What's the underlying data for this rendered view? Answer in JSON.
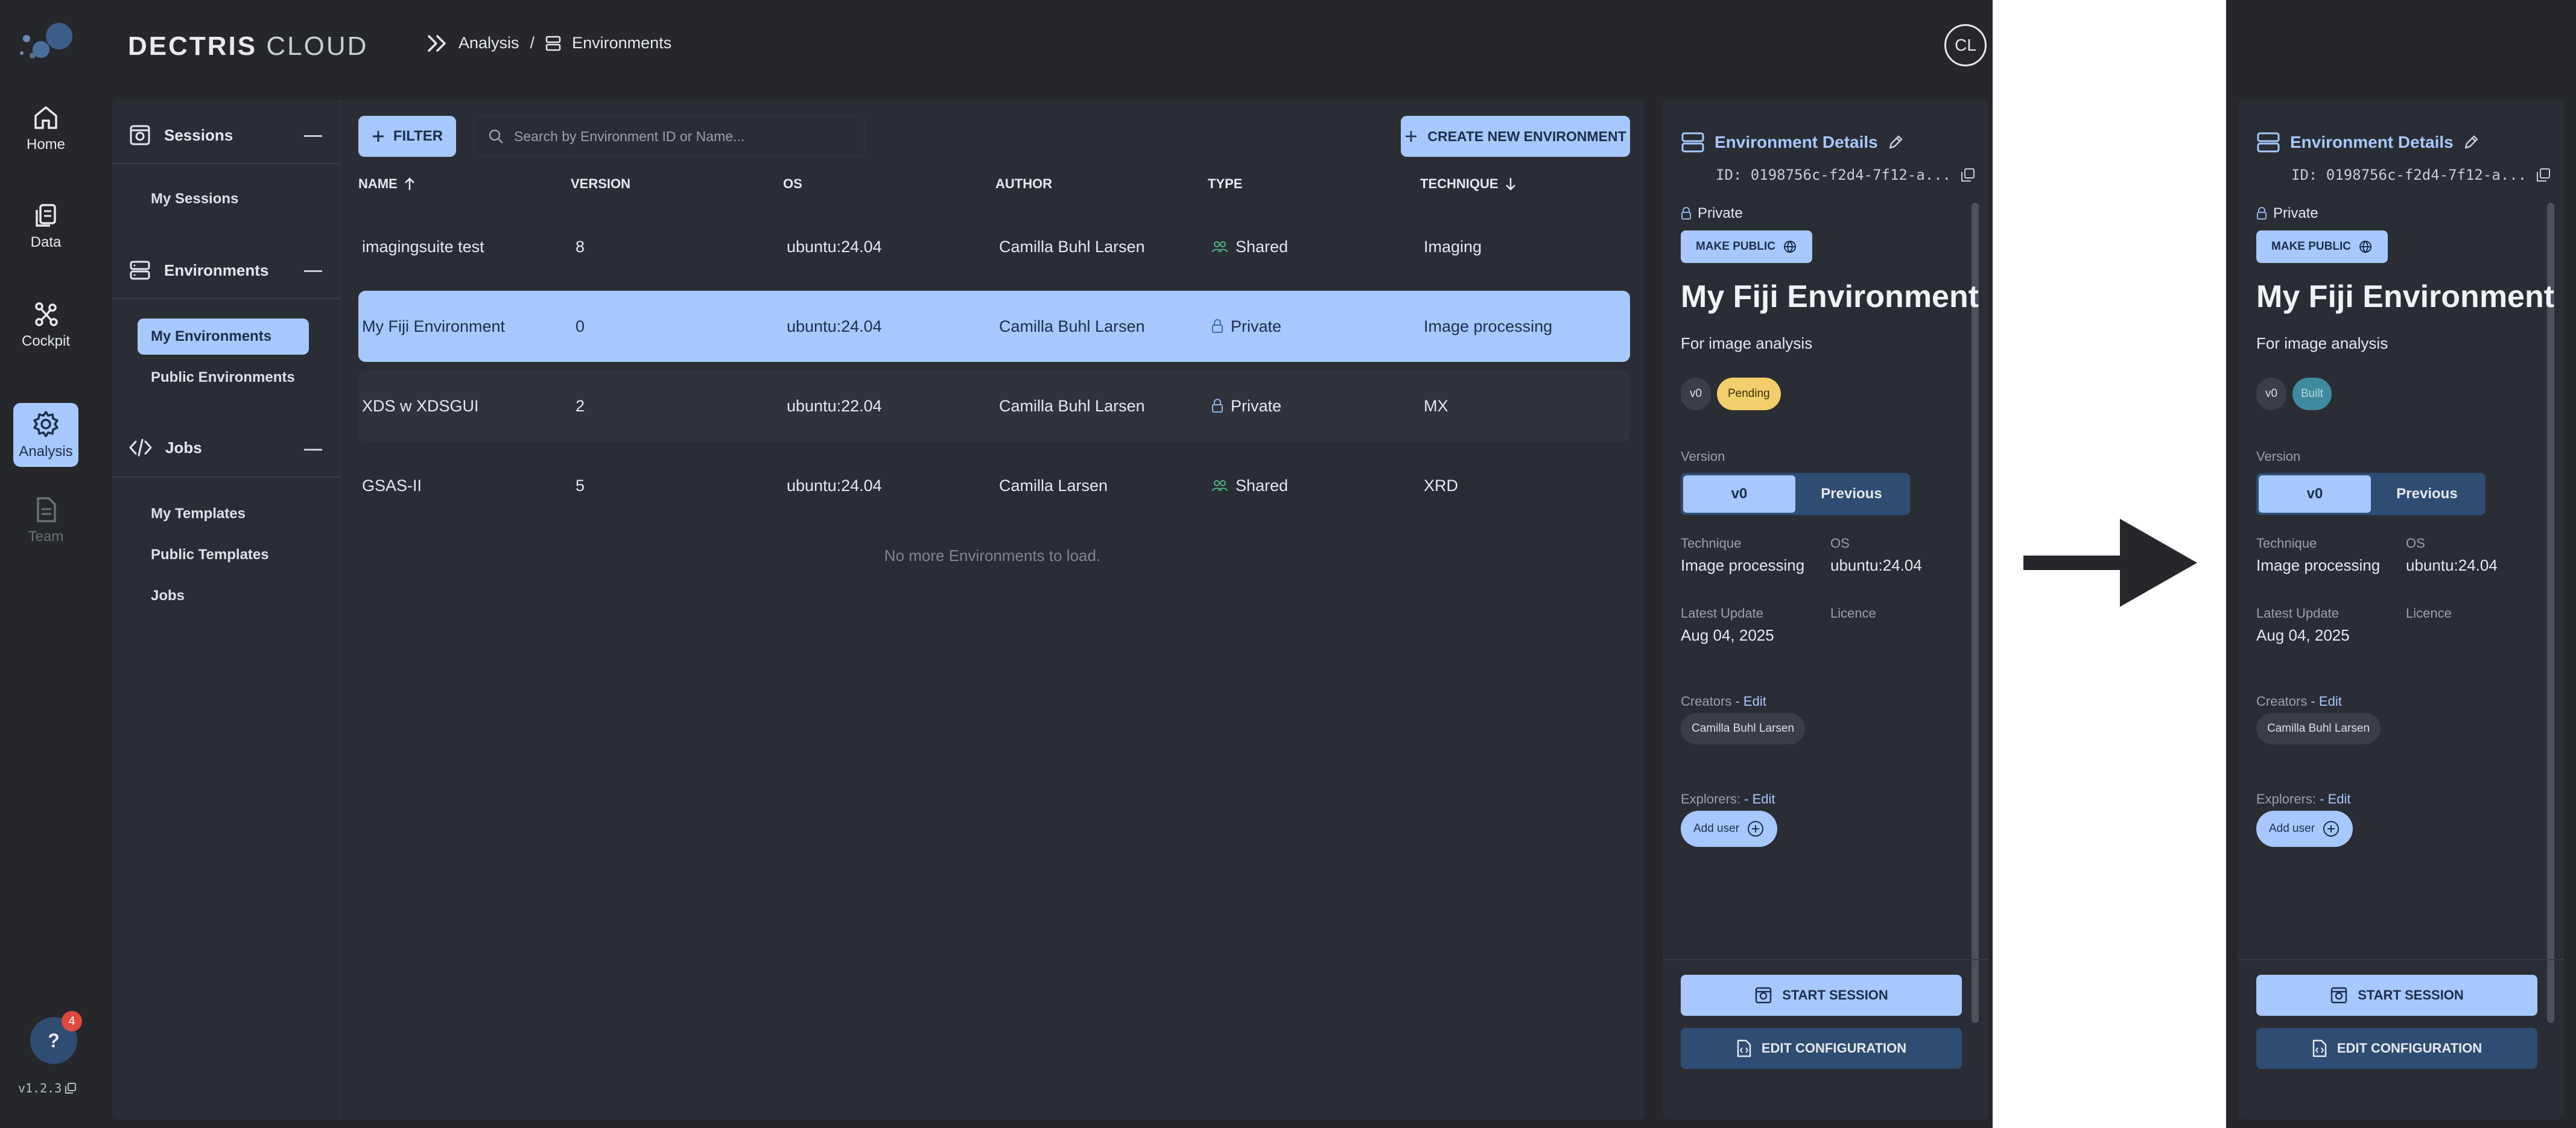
{
  "brand": {
    "bold": "DECTRIS",
    "light": "CLOUD"
  },
  "breadcrumb": {
    "section": "Analysis",
    "separator": "/",
    "page": "Environments"
  },
  "user": {
    "initials": "CL"
  },
  "rail": {
    "items": [
      {
        "label": "Home",
        "icon": "home-icon"
      },
      {
        "label": "Data",
        "icon": "data-icon"
      },
      {
        "label": "Cockpit",
        "icon": "cockpit-icon"
      },
      {
        "label": "Analysis",
        "icon": "gear-icon",
        "active": true
      },
      {
        "label": "Team",
        "icon": "document-icon",
        "disabled": true
      }
    ],
    "help": {
      "label": "?",
      "badge": "4"
    },
    "version": "v1.2.3"
  },
  "nav": {
    "sessions": {
      "title": "Sessions",
      "items": [
        "My Sessions"
      ]
    },
    "environments": {
      "title": "Environments",
      "items": [
        "My Environments",
        "Public Environments"
      ]
    },
    "jobs": {
      "title": "Jobs",
      "items": [
        "My Templates",
        "Public Templates",
        "Jobs"
      ]
    }
  },
  "toolbar": {
    "filter_label": "FILTER",
    "search_placeholder": "Search by Environment ID or Name...",
    "create_label": "CREATE NEW ENVIRONMENT"
  },
  "table": {
    "headers": {
      "name": "NAME",
      "version": "VERSION",
      "os": "OS",
      "author": "AUTHOR",
      "type": "TYPE",
      "technique": "TECHNIQUE"
    },
    "rows": [
      {
        "name": "imagingsuite test",
        "version": "8",
        "os": "ubuntu:24.04",
        "author": "Camilla Buhl Larsen",
        "type": "Shared",
        "technique": "Imaging"
      },
      {
        "name": "My Fiji Environment",
        "version": "0",
        "os": "ubuntu:24.04",
        "author": "Camilla Buhl Larsen",
        "type": "Private",
        "technique": "Image processing"
      },
      {
        "name": "XDS w XDSGUI",
        "version": "2",
        "os": "ubuntu:22.04",
        "author": "Camilla Buhl Larsen",
        "type": "Private",
        "technique": "MX"
      },
      {
        "name": "GSAS-II",
        "version": "5",
        "os": "ubuntu:24.04",
        "author": "Camilla Larsen",
        "type": "Shared",
        "technique": "XRD"
      }
    ],
    "empty_message": "No more Environments to load."
  },
  "details": {
    "header": "Environment Details",
    "id": "ID: 0198756c-f2d4-7f12-a...",
    "visibility": "Private",
    "make_public_label": "MAKE PUBLIC",
    "title": "My Fiji Environment",
    "description": "For image analysis",
    "version_chip": "v0",
    "status_left": "Pending",
    "status_right": "Built",
    "version_label": "Version",
    "version_current": "v0",
    "version_previous": "Previous",
    "technique_label": "Technique",
    "technique_value": "Image processing",
    "os_label": "OS",
    "os_value": "ubuntu:24.04",
    "latest_update_label": "Latest Update",
    "latest_update_value": "Aug 04, 2025",
    "licence_label": "Licence",
    "creators_label": "Creators",
    "explorers_label": "Explorers:",
    "edit_label": "- Edit",
    "creator": "Camilla Buhl Larsen",
    "add_user_label": "Add user",
    "start_session_label": "START SESSION",
    "edit_config_label": "EDIT CONFIGURATION"
  },
  "colors": {
    "background": "#25272b",
    "panel": "#2a2d33",
    "accent": "#a6c8ff",
    "accent_dark": "#2f4c73",
    "pending": "#f2cf6b",
    "built": "#3e8a9e",
    "shared_icon": "#4fb38a"
  }
}
